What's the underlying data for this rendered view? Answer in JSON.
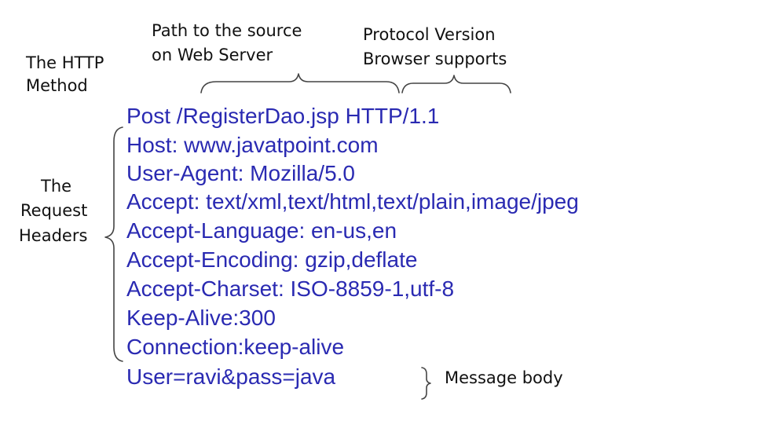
{
  "annotations": {
    "method_line1": "The HTTP",
    "method_line2": "Method",
    "path_line1": "Path to the source",
    "path_line2": "on Web Server",
    "protocol_line1": "Protocol Version",
    "protocol_line2": "Browser supports",
    "headers_line1": "The",
    "headers_line2": "Request",
    "headers_line3": "Headers",
    "body_label": "Message body"
  },
  "request": {
    "request_line": "Post /RegisterDao.jsp HTTP/1.1",
    "headers": [
      "Host: www.javatpoint.com",
      "User-Agent: Mozilla/5.0",
      "Accept: text/xml,text/html,text/plain,image/jpeg",
      "Accept-Language: en-us,en",
      "Accept-Encoding: gzip,deflate",
      "Accept-Charset: ISO-8859-1,utf-8",
      "Keep-Alive:300",
      "Connection:keep-alive"
    ],
    "body": "User=ravi&pass=java"
  },
  "colors": {
    "request_text": "#2a2ab2",
    "annotation_text": "#111111",
    "brace": "#444444",
    "background": "#ffffff"
  }
}
